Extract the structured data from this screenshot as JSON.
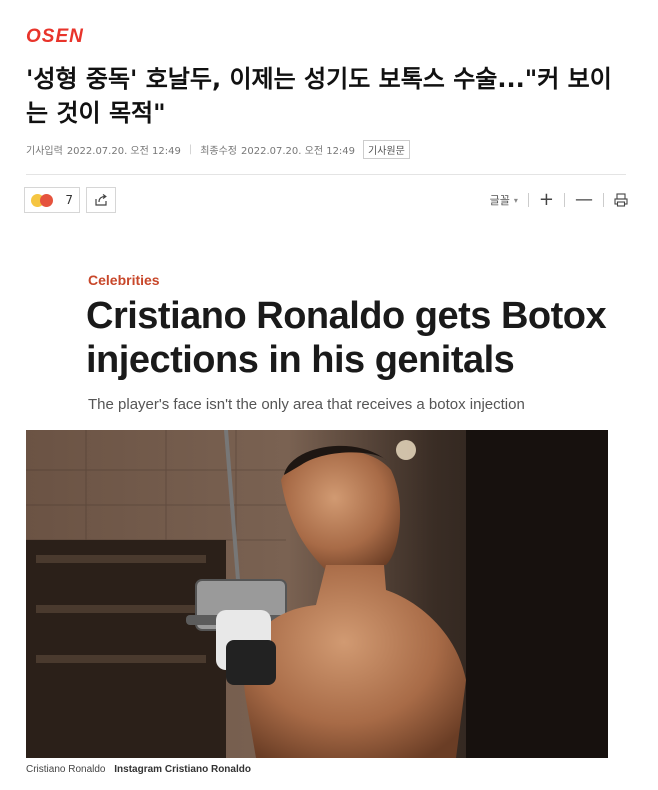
{
  "brand": {
    "logo_text": "OSEN",
    "accent": "#e8342b"
  },
  "article": {
    "headline": "'성형 중독' 호날두, 이제는 성기도 보톡스 수술...\"커 보이는 것이 목적\"",
    "published_label": "기사입력",
    "published_time": "2022.07.20. 오전 12:49",
    "modified_label": "최종수정",
    "modified_time": "2022.07.20. 오전 12:49",
    "original_link": "기사원문"
  },
  "toolbar": {
    "reaction_count": "7",
    "font_size_label": "글꼴",
    "zoom_in_symbol": "+",
    "zoom_out_symbol": "—"
  },
  "embed": {
    "category": "Celebrities",
    "title": "Cristiano Ronaldo gets Botox injections in his genitals",
    "subtitle": "The player's face isn't the only area that receives a botox injection",
    "caption_name": "Cristiano Ronaldo",
    "caption_credit": "Instagram Cristiano Ronaldo"
  }
}
